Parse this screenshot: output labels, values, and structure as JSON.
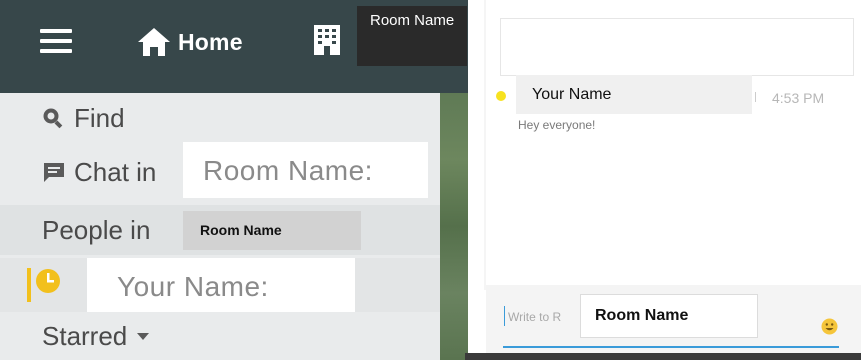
{
  "header": {
    "home_label": "Home",
    "room_tooltip": "Room Name"
  },
  "nav": {
    "find_label": "Find",
    "chat_label": "Chat in",
    "room_name_field": "Room Name:",
    "people_label": "People in",
    "people_room_badge": "Room Name",
    "your_name_field": "Your Name:",
    "starred_label": "Starred"
  },
  "chat": {
    "message": {
      "sender": "Your Name",
      "time": "4:53 PM",
      "text": "Hey everyone!"
    },
    "composer": {
      "placeholder": "Write to R",
      "room_badge": "Room Name"
    }
  },
  "colors": {
    "topbar": "#37474a",
    "sidebar_bg": "#e9ebec",
    "accent_yellow": "#f2c01c",
    "presence_yellow": "#f7e21f",
    "composer_underline": "#3a9bd9"
  },
  "icons": [
    "menu-icon",
    "home-icon",
    "building-icon",
    "search-icon",
    "chat-icon",
    "clock-icon",
    "chevron-down-icon",
    "emoji-icon"
  ]
}
